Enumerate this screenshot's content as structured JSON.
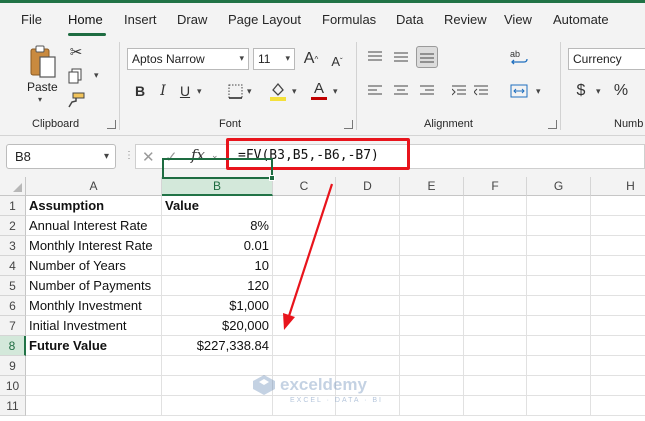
{
  "tabs": [
    "File",
    "Home",
    "Insert",
    "Draw",
    "Page Layout",
    "Formulas",
    "Data",
    "Review",
    "View",
    "Automate"
  ],
  "active_tab": "Home",
  "ribbon": {
    "paste_label": "Paste",
    "clipboard_group": "Clipboard",
    "font_group": "Font",
    "alignment_group": "Alignment",
    "number_group": "Numb",
    "font_name": "Aptos Narrow",
    "font_size": "11",
    "number_format": "Currency",
    "bold_label": "B",
    "italic_label": "I",
    "underline_label": "U",
    "grow_font": "A",
    "shrink_font": "A",
    "font_color_label": "A",
    "currency_symbol": "$",
    "percent_symbol": "%"
  },
  "formula_bar": {
    "name_box": "B8",
    "fx_label": "fx",
    "formula": "=FV(B3,B5,-B6,-B7)"
  },
  "columns": [
    "A",
    "B",
    "C",
    "D",
    "E",
    "F",
    "G",
    "H"
  ],
  "rows": [
    "1",
    "2",
    "3",
    "4",
    "5",
    "6",
    "7",
    "8",
    "9",
    "10",
    "11"
  ],
  "cells": {
    "A1": "Assumption",
    "B1": "Value",
    "A2": "Annual Interest Rate",
    "B2": "8%",
    "A3": "Monthly Interest Rate",
    "B3": "0.01",
    "A4": "Number of Years",
    "B4": "10",
    "A5": "Number of Payments",
    "B5": "120",
    "A6": "Monthly Investment",
    "B6": "$1,000",
    "A7": "Initial Investment",
    "B7": "$20,000",
    "A8": "Future Value",
    "B8": "$227,338.84"
  },
  "selected_cell": "B8",
  "watermark": {
    "name": "exceldemy",
    "tagline": "EXCEL · DATA · BI"
  },
  "colors": {
    "accent": "#217346",
    "highlight": "#e8141c"
  }
}
